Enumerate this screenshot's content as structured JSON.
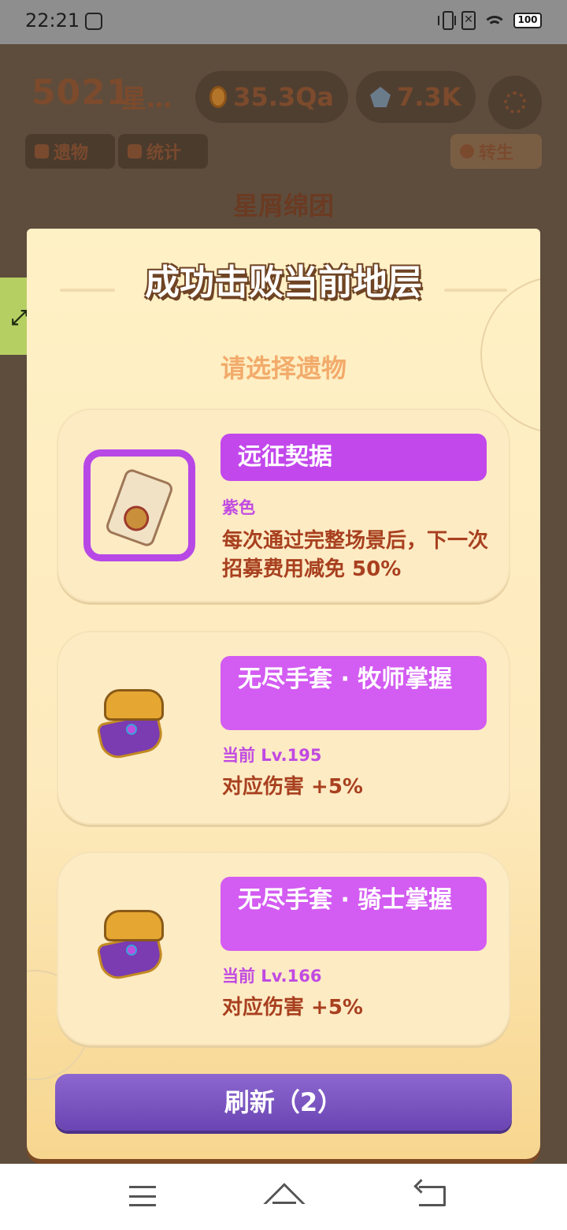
{
  "status_bar": {
    "time": "22:21",
    "battery": "100",
    "no_sim_glyph": "✕"
  },
  "hud": {
    "floor_count": "5021",
    "floor_suffix": "星…",
    "coins": "35.3Qa",
    "gems": "7.3K",
    "tabs": {
      "relics": "遗物",
      "stats": "统计",
      "rebirth": "转生"
    },
    "boss_name": "星屑绵团"
  },
  "modal": {
    "title": "成功击败当前地层",
    "subtitle": "请选择遗物",
    "relics": [
      {
        "name": "远征契据",
        "tag": "紫色",
        "description": "每次通过完整场景后，下一次招募费用减免 50%",
        "icon": "scroll-icon",
        "rarity_color": "#b748e6"
      },
      {
        "name": "无尽手套 · 牧师掌握",
        "tag": "当前 Lv.195",
        "description": "对应伤害 +5%",
        "icon": "gauntlet-icon"
      },
      {
        "name": "无尽手套 · 骑士掌握",
        "tag": "当前 Lv.166",
        "description": "对应伤害 +5%",
        "icon": "gauntlet-icon"
      }
    ],
    "refresh_label": "刷新（2）"
  },
  "colors": {
    "accent_purple": "#c248ec",
    "description_red": "#a8401f",
    "subtitle_orange": "#f2ab6b",
    "refresh_purple": "#7a55c2"
  }
}
